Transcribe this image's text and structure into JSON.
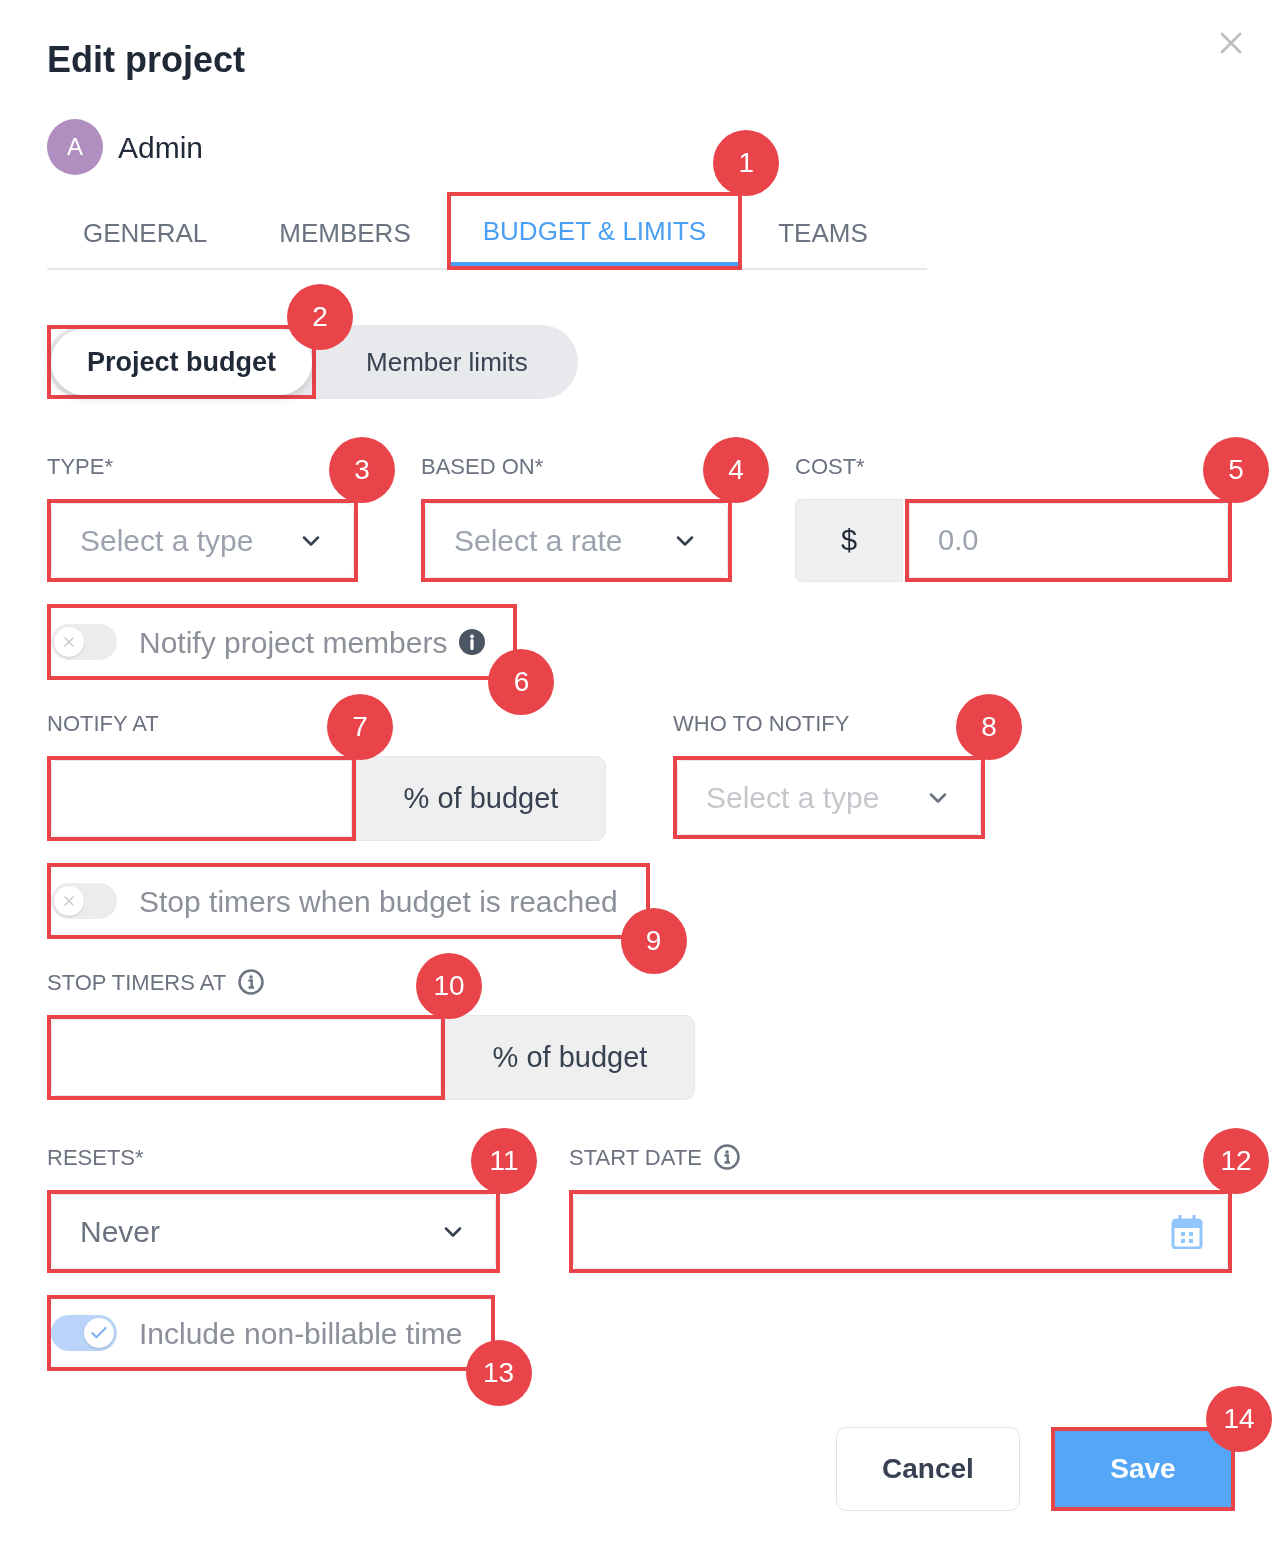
{
  "dialog": {
    "title": "Edit project"
  },
  "user": {
    "initial": "A",
    "name": "Admin"
  },
  "tabs": [
    {
      "label": "GENERAL",
      "selected": false
    },
    {
      "label": "MEMBERS",
      "selected": false
    },
    {
      "label": "BUDGET & LIMITS",
      "selected": true,
      "callout": "1"
    },
    {
      "label": "TEAMS",
      "selected": false
    }
  ],
  "segments": [
    {
      "label": "Project budget",
      "selected": true,
      "callout": "2"
    },
    {
      "label": "Member limits",
      "selected": false
    }
  ],
  "form": [
    {
      "kind": "fields",
      "fields": [
        {
          "kind": "select",
          "label": "TYPE*",
          "placeholder": "Select a type",
          "disabled": false,
          "callout": "3"
        },
        {
          "kind": "select",
          "label": "BASED ON*",
          "placeholder": "Select a rate",
          "disabled": false,
          "callout": "4"
        },
        {
          "kind": "prefixed",
          "label": "COST*",
          "prefix": "$",
          "placeholder": "0.0",
          "callout": "5"
        }
      ]
    },
    {
      "kind": "toggle",
      "label": "Notify project members",
      "on": false,
      "info": true,
      "callout": "6"
    },
    {
      "kind": "fields",
      "fields": [
        {
          "kind": "suffixed",
          "label": "NOTIFY AT",
          "suffix": "% of budget",
          "callout": "7"
        },
        {
          "kind": "select",
          "label": "WHO TO NOTIFY",
          "placeholder": "Select a type",
          "disabled": true,
          "callout": "8"
        }
      ]
    },
    {
      "kind": "toggle",
      "label": "Stop timers when budget is reached",
      "on": false,
      "callout": "9"
    },
    {
      "kind": "fields",
      "fields": [
        {
          "kind": "suffixed",
          "label": "STOP TIMERS AT",
          "info": true,
          "suffix": "% of budget",
          "callout": "10"
        }
      ]
    },
    {
      "kind": "fields",
      "fields": [
        {
          "kind": "select",
          "label": "RESETS*",
          "value": "Never",
          "disabled": false,
          "callout": "11"
        },
        {
          "kind": "date",
          "label": "START DATE",
          "info": true,
          "callout": "12"
        }
      ]
    },
    {
      "kind": "toggle",
      "label": "Include non-billable time",
      "on": true,
      "callout": "13"
    }
  ],
  "buttons": [
    {
      "label": "Cancel",
      "kind": "secondary"
    },
    {
      "label": "Save",
      "kind": "primary",
      "callout": "14"
    }
  ]
}
